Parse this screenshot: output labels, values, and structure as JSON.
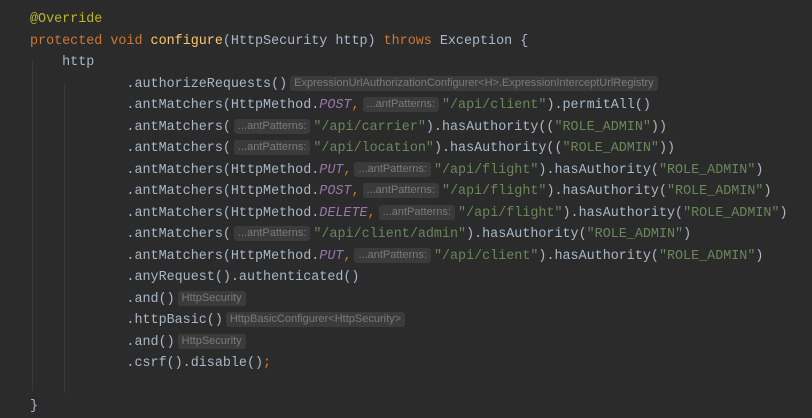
{
  "lines": [
    [
      {
        "t": "@Override",
        "c": "ann"
      }
    ],
    [
      {
        "t": "protected void ",
        "c": "kw"
      },
      {
        "t": "configure",
        "c": "fn"
      },
      {
        "t": "(HttpSecurity http) "
      },
      {
        "t": "throws ",
        "c": "kw"
      },
      {
        "t": "Exception {"
      }
    ],
    [
      {
        "t": "    http"
      }
    ],
    [
      {
        "t": "            .authorizeRequests()"
      },
      {
        "t": "ExpressionUrlAuthorizationConfigurer<H>.ExpressionInterceptUrlRegistry",
        "c": "hint"
      }
    ],
    [
      {
        "t": "            .antMatchers(HttpMethod."
      },
      {
        "t": "POST",
        "c": "st"
      },
      {
        "t": ",",
        "c": "kw"
      },
      {
        "t": "...antPatterns:",
        "c": "hint"
      },
      {
        "t": "\"/api/client\"",
        "c": "str"
      },
      {
        "t": ").permitAll()"
      }
    ],
    [
      {
        "t": "            .antMatchers("
      },
      {
        "t": "...antPatterns:",
        "c": "hint"
      },
      {
        "t": "\"/api/carrier\"",
        "c": "str"
      },
      {
        "t": ").hasAuthority(("
      },
      {
        "t": "\"ROLE_ADMIN\"",
        "c": "str"
      },
      {
        "t": "))"
      }
    ],
    [
      {
        "t": "            .antMatchers("
      },
      {
        "t": "...antPatterns:",
        "c": "hint"
      },
      {
        "t": "\"/api/location\"",
        "c": "str"
      },
      {
        "t": ").hasAuthority(("
      },
      {
        "t": "\"ROLE_ADMIN\"",
        "c": "str"
      },
      {
        "t": "))"
      }
    ],
    [
      {
        "t": "            .antMatchers(HttpMethod."
      },
      {
        "t": "PUT",
        "c": "st"
      },
      {
        "t": ",",
        "c": "kw"
      },
      {
        "t": "...antPatterns:",
        "c": "hint"
      },
      {
        "t": "\"/api/flight\"",
        "c": "str"
      },
      {
        "t": ").hasAuthority("
      },
      {
        "t": "\"ROLE_ADMIN\"",
        "c": "str"
      },
      {
        "t": ")"
      }
    ],
    [
      {
        "t": "            .antMatchers(HttpMethod."
      },
      {
        "t": "POST",
        "c": "st"
      },
      {
        "t": ",",
        "c": "kw"
      },
      {
        "t": "...antPatterns:",
        "c": "hint"
      },
      {
        "t": "\"/api/flight\"",
        "c": "str"
      },
      {
        "t": ").hasAuthority("
      },
      {
        "t": "\"ROLE_ADMIN\"",
        "c": "str"
      },
      {
        "t": ")"
      }
    ],
    [
      {
        "t": "            .antMatchers(HttpMethod."
      },
      {
        "t": "DELETE",
        "c": "st"
      },
      {
        "t": ",",
        "c": "kw"
      },
      {
        "t": "...antPatterns:",
        "c": "hint"
      },
      {
        "t": "\"/api/flight\"",
        "c": "str"
      },
      {
        "t": ").hasAuthority("
      },
      {
        "t": "\"ROLE_ADMIN\"",
        "c": "str"
      },
      {
        "t": ")"
      }
    ],
    [
      {
        "t": "            .antMatchers("
      },
      {
        "t": "...antPatterns:",
        "c": "hint"
      },
      {
        "t": "\"/api/client/admin\"",
        "c": "str"
      },
      {
        "t": ").hasAuthority("
      },
      {
        "t": "\"ROLE_ADMIN\"",
        "c": "str"
      },
      {
        "t": ")"
      }
    ],
    [
      {
        "t": "            .antMatchers(HttpMethod."
      },
      {
        "t": "PUT",
        "c": "st"
      },
      {
        "t": ",",
        "c": "kw"
      },
      {
        "t": "...antPatterns:",
        "c": "hint"
      },
      {
        "t": "\"/api/client\"",
        "c": "str"
      },
      {
        "t": ").hasAuthority("
      },
      {
        "t": "\"ROLE_ADMIN\"",
        "c": "str"
      },
      {
        "t": ")"
      }
    ],
    [
      {
        "t": "            .anyRequest().authenticated()"
      }
    ],
    [
      {
        "t": "            .and()"
      },
      {
        "t": "HttpSecurity",
        "c": "hint"
      }
    ],
    [
      {
        "t": "            .httpBasic()"
      },
      {
        "t": "HttpBasicConfigurer<HttpSecurity>",
        "c": "hint"
      }
    ],
    [
      {
        "t": "            .and()"
      },
      {
        "t": "HttpSecurity",
        "c": "hint"
      }
    ],
    [
      {
        "t": "            .csrf().disable()"
      },
      {
        "t": ";",
        "c": "kw"
      }
    ],
    [],
    [
      {
        "t": "}"
      }
    ]
  ]
}
